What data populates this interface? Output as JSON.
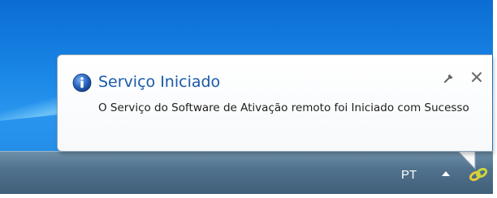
{
  "notification": {
    "title": "Serviço Iniciado",
    "message": "O Serviço do Software de Ativação remoto foi Iniciado com Sucesso",
    "icon": "info-icon",
    "options_icon": "wrench-icon",
    "close_icon": "close-icon",
    "title_color": "#1a5aa8"
  },
  "taskbar": {
    "language": "PT",
    "tray_expand_icon": "chevron-up-icon",
    "tray_app_icon": "chain-link-icon"
  },
  "desktop": {
    "accent": "#1a86e6"
  }
}
